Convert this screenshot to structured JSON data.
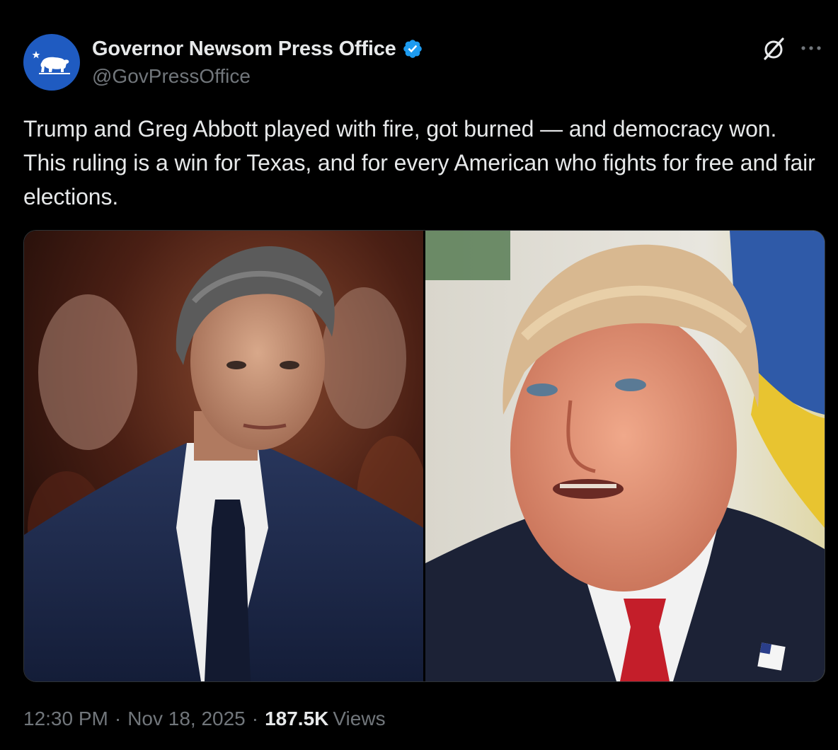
{
  "tweet": {
    "display_name": "Governor Newsom Press Office",
    "handle": "@GovPressOffice",
    "text": "Trump and Greg Abbott played with fire, got burned — and democracy won. This ruling is a win for Texas, and for every American who fights for free and fair elections.",
    "time": "12:30 PM",
    "separator": "·",
    "date": "Nov 18, 2025",
    "views_count": "187.5K",
    "views_label": "Views"
  },
  "icons": {
    "verified": "verified-badge-icon",
    "grok": "grok-icon",
    "more": "more-options-icon",
    "avatar": "california-bear-avatar"
  },
  "colors": {
    "background": "#000000",
    "text_primary": "#e7e9ea",
    "text_secondary": "#71767b",
    "verified_blue": "#1d9bf0",
    "avatar_blue": "#1f5bc1",
    "border": "#2f3336"
  },
  "media": {
    "count": 2
  }
}
